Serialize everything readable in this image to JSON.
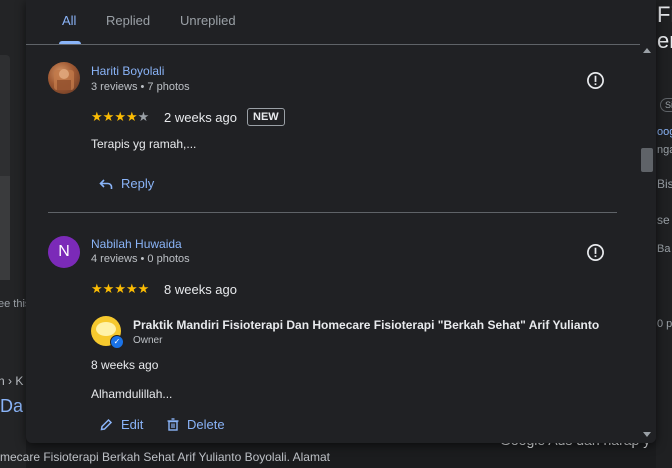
{
  "background": {
    "left_caption": "ee this",
    "breadcrumb_fragment": "n › K",
    "heading_fragment": "Da",
    "bottom_text": "mecare Fisioterapi Berkah Sehat Arif Yulianto Boyolali. Alamat",
    "right_big_1": "Fisi",
    "right_big_2": "en",
    "right_chip": "Si",
    "right_link_1": "oog",
    "right_gray_1": "nga",
    "right_gray_2": "Bis",
    "right_gray_3": "se",
    "right_gray_4": "Ba",
    "right_gray_5": "0 pr",
    "right_bottom": "Google Ads dan harap y"
  },
  "tabs": [
    {
      "label": "All",
      "active": true
    },
    {
      "label": "Replied",
      "active": false
    },
    {
      "label": "Unreplied",
      "active": false
    }
  ],
  "reviews": [
    {
      "reviewer": "Hariti Boyolali",
      "meta": "3 reviews • 7 photos",
      "rating": 4,
      "when": "2 weeks ago",
      "badge": "NEW",
      "text": "Terapis yg ramah,...",
      "action": "Reply"
    },
    {
      "reviewer": "Nabilah Huwaida",
      "initial": "N",
      "meta": "4 reviews • 0 photos",
      "rating": 5,
      "when": "8 weeks ago",
      "owner_reply": {
        "owner_name": "Praktik Mandiri Fisioterapi Dan Homecare Fisioterapi \"Berkah Sehat\" Arif Yulianto",
        "role": "Owner",
        "when": "8 weeks ago",
        "text": "Alhamdulillah...",
        "edit_label": "Edit",
        "delete_label": "Delete"
      }
    }
  ],
  "colors": {
    "accent": "#8ab4f8",
    "star": "#fbbc04",
    "dialog_bg": "#202124",
    "avatar_n": "#7b2ab8"
  }
}
